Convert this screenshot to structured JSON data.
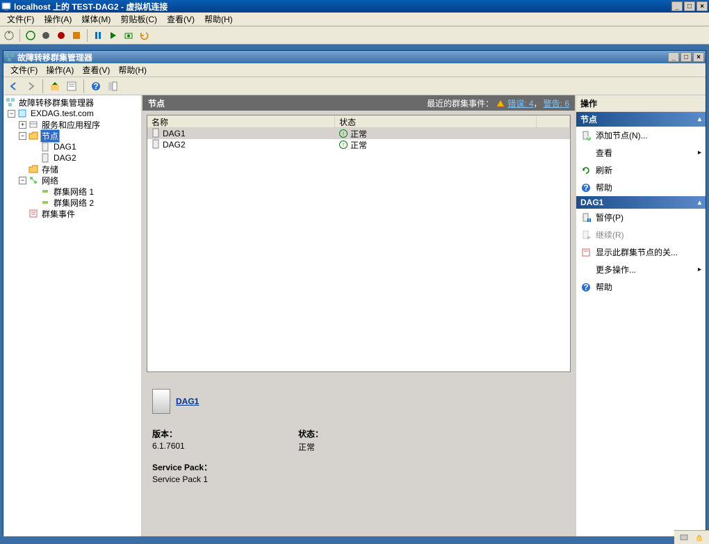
{
  "vm": {
    "title": "localhost 上的 TEST-DAG2 - 虚拟机连接",
    "menu": [
      "文件(F)",
      "操作(A)",
      "媒体(M)",
      "剪贴板(C)",
      "查看(V)",
      "帮助(H)"
    ]
  },
  "mmc": {
    "title": "故障转移群集管理器",
    "menu": [
      "文件(F)",
      "操作(A)",
      "查看(V)",
      "帮助(H)"
    ]
  },
  "tree": {
    "root": "故障转移群集管理器",
    "cluster": "EXDAG.test.com",
    "services": "服务和应用程序",
    "nodes_label": "节点",
    "nodes": [
      "DAG1",
      "DAG2"
    ],
    "storage": "存储",
    "networks_label": "网络",
    "networks": [
      "群集网络 1",
      "群集网络 2"
    ],
    "events": "群集事件"
  },
  "center": {
    "header": "节点",
    "recent_label": "最近的群集事件：",
    "error_link": "错误: 4",
    "warn_link": "警告: 6",
    "col_name": "名称",
    "col_status": "状态",
    "rows": [
      {
        "name": "DAG1",
        "status": "正常"
      },
      {
        "name": "DAG2",
        "status": "正常"
      }
    ]
  },
  "detail": {
    "name": "DAG1",
    "version_label": "版本：",
    "version": "6.1.7601",
    "status_label": "状态：",
    "status": "正常",
    "sp_label": "Service Pack：",
    "sp": "Service Pack 1"
  },
  "actions": {
    "title": "操作",
    "section1": "节点",
    "add_node": "添加节点(N)...",
    "view": "查看",
    "refresh": "刷新",
    "help": "帮助",
    "section2": "DAG1",
    "pause": "暂停(P)",
    "resume": "继续(R)",
    "show_crit": "显示此群集节点的关...",
    "more_ops": "更多操作...",
    "help2": "帮助"
  }
}
